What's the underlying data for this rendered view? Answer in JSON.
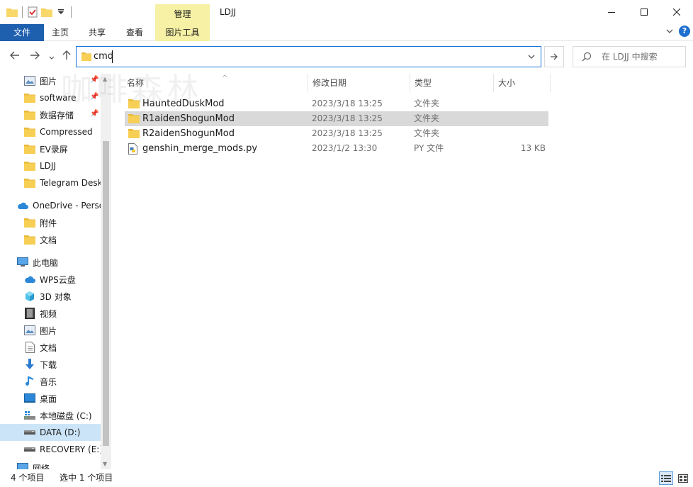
{
  "window": {
    "title": "LDJJ",
    "context_tab_header": "管理"
  },
  "ribbon": {
    "tabs": [
      "文件",
      "主页",
      "共享",
      "查看",
      "图片工具"
    ]
  },
  "address": {
    "value": "cmd"
  },
  "search": {
    "placeholder": "在 LDJJ 中搜索"
  },
  "watermark": "咖啡森林",
  "nav": {
    "quick_access": [
      {
        "label": "图片",
        "icon": "pictures-icon",
        "pinned": true
      },
      {
        "label": "software",
        "icon": "folder-icon",
        "pinned": true
      },
      {
        "label": "数据存储",
        "icon": "folder-icon",
        "pinned": true
      },
      {
        "label": "Compressed",
        "icon": "folder-icon",
        "pinned": false
      },
      {
        "label": "EV录屏",
        "icon": "folder-icon",
        "pinned": false
      },
      {
        "label": "LDJJ",
        "icon": "folder-icon",
        "pinned": false
      },
      {
        "label": "Telegram Desktop",
        "icon": "folder-icon",
        "pinned": false
      }
    ],
    "onedrive": {
      "label": "OneDrive - Personal"
    },
    "onedrive_items": [
      {
        "label": "附件",
        "icon": "folder-icon"
      },
      {
        "label": "文档",
        "icon": "folder-icon"
      }
    ],
    "this_pc": {
      "label": "此电脑"
    },
    "pc_items": [
      {
        "label": "WPS云盘",
        "icon": "cloud-icon"
      },
      {
        "label": "3D 对象",
        "icon": "cube-icon"
      },
      {
        "label": "视频",
        "icon": "video-icon"
      },
      {
        "label": "图片",
        "icon": "pictures-icon"
      },
      {
        "label": "文档",
        "icon": "document-icon"
      },
      {
        "label": "下载",
        "icon": "download-icon"
      },
      {
        "label": "音乐",
        "icon": "music-icon"
      },
      {
        "label": "桌面",
        "icon": "desktop-icon"
      },
      {
        "label": "本地磁盘 (C:)",
        "icon": "system-drive-icon"
      },
      {
        "label": "DATA (D:)",
        "icon": "drive-icon",
        "selected": true
      },
      {
        "label": "RECOVERY (E:)",
        "icon": "drive-icon"
      }
    ],
    "network": {
      "label": "网络"
    }
  },
  "columns": [
    "名称",
    "修改日期",
    "类型",
    "大小"
  ],
  "files": [
    {
      "name": "HauntedDuskMod",
      "date": "2023/3/18 13:25",
      "type": "文件夹",
      "size": "",
      "icon": "folder-icon"
    },
    {
      "name": "R1aidenShogunMod",
      "date": "2023/3/18 13:25",
      "type": "文件夹",
      "size": "",
      "icon": "folder-icon",
      "selected": true
    },
    {
      "name": "R2aidenShogunMod",
      "date": "2023/3/18 13:25",
      "type": "文件夹",
      "size": "",
      "icon": "folder-icon"
    },
    {
      "name": "genshin_merge_mods.py",
      "date": "2023/1/2 13:30",
      "type": "PY 文件",
      "size": "13 KB",
      "icon": "python-file-icon"
    }
  ],
  "status": {
    "count": "4 个项目",
    "selected": "选中 1 个项目"
  },
  "colors": {
    "file_tab": "#1e5fae",
    "context_tab": "#f6f1a5",
    "folder": "#f7cf55",
    "selection": "#d9d9d9",
    "nav_selection": "#cce4f7",
    "address_border": "#1a73d9"
  }
}
